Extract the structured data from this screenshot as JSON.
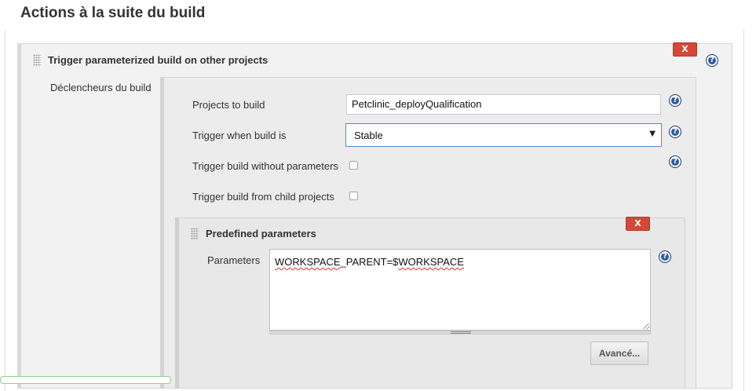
{
  "section_title": "Actions à la suite du build",
  "trigger_section": {
    "heading": "Trigger parameterized build on other projects",
    "delete_label": "X",
    "triggers_label": "Déclencheurs du build",
    "projects_label": "Projects to build",
    "projects_value": "Petclinic_deployQualification",
    "trigger_when_label": "Trigger when build is",
    "trigger_when_value": "Stable",
    "trigger_without_params_label": "Trigger build without parameters",
    "trigger_without_params_checked": false,
    "trigger_from_child_label": "Trigger build from child projects",
    "trigger_from_child_checked": false
  },
  "predefined": {
    "heading": "Predefined parameters",
    "delete_label": "X",
    "parameters_label": "Parameters",
    "parameters_value_prefix": "WORKSPACE",
    "parameters_value_middle": "_PARENT=$",
    "parameters_value_suffix": "WORKSPACE",
    "advanced_button": "Avancé..."
  },
  "icons": {
    "help": "help-icon",
    "delete": "close-icon",
    "drag": "drag-handle-icon",
    "dropdown": "chevron-down-icon"
  },
  "colors": {
    "delete_button": "#d24939",
    "help_icon": "#2f5b9a",
    "select_focus": "#5b86c5"
  }
}
